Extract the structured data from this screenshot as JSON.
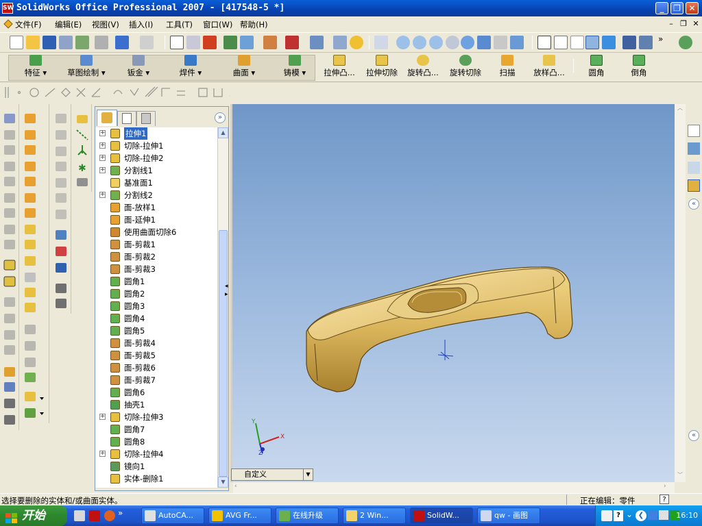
{
  "window": {
    "title": "SolidWorks Office Professional 2007 - [417548-5 *]",
    "app_icon_text": "SW",
    "colors": {
      "titlebar": "#0a4fc4",
      "selection": "#316ac5",
      "part": "#d8b155"
    }
  },
  "menubar": {
    "items": [
      "文件(F)",
      "编辑(E)",
      "视图(V)",
      "插入(I)",
      "工具(T)",
      "窗口(W)",
      "帮助(H)"
    ],
    "mdi_controls": [
      "–",
      "❐",
      "✕"
    ]
  },
  "command_manager": {
    "left_tabs": [
      "特征",
      "草图绘制",
      "钣金",
      "焊件",
      "曲面",
      "铸模"
    ],
    "commands": [
      "拉伸凸...",
      "拉伸切除",
      "旋转凸...",
      "旋转切除",
      "扫描",
      "放样凸...",
      "圆角",
      "倒角"
    ]
  },
  "feature_tree": {
    "items": [
      {
        "label": "拉伸1",
        "expand": "+",
        "icon": "extrude-boss-icon",
        "selected": true
      },
      {
        "label": "切除-拉伸1",
        "expand": "+",
        "icon": "cut-extrude-icon"
      },
      {
        "label": "切除-拉伸2",
        "expand": "+",
        "icon": "cut-extrude-icon"
      },
      {
        "label": "分割线1",
        "expand": "+",
        "icon": "split-line-icon"
      },
      {
        "label": "基准面1",
        "expand": "",
        "icon": "plane-icon"
      },
      {
        "label": "分割线2",
        "expand": "+",
        "icon": "split-line-icon"
      },
      {
        "label": "面-放样1",
        "expand": "",
        "icon": "surface-loft-icon"
      },
      {
        "label": "面-延伸1",
        "expand": "",
        "icon": "surface-extend-icon"
      },
      {
        "label": "使用曲面切除6",
        "expand": "",
        "icon": "surface-cut-icon"
      },
      {
        "label": "面-剪裁1",
        "expand": "",
        "icon": "surface-trim-icon"
      },
      {
        "label": "面-剪裁2",
        "expand": "",
        "icon": "surface-trim-icon"
      },
      {
        "label": "面-剪裁3",
        "expand": "",
        "icon": "surface-trim-icon"
      },
      {
        "label": "圆角1",
        "expand": "",
        "icon": "fillet-icon"
      },
      {
        "label": "圆角2",
        "expand": "",
        "icon": "fillet-icon"
      },
      {
        "label": "圆角3",
        "expand": "",
        "icon": "fillet-icon"
      },
      {
        "label": "圆角4",
        "expand": "",
        "icon": "fillet-icon"
      },
      {
        "label": "圆角5",
        "expand": "",
        "icon": "fillet-icon"
      },
      {
        "label": "面-剪裁4",
        "expand": "",
        "icon": "surface-trim-icon"
      },
      {
        "label": "面-剪裁5",
        "expand": "",
        "icon": "surface-trim-icon"
      },
      {
        "label": "面-剪裁6",
        "expand": "",
        "icon": "surface-trim-icon"
      },
      {
        "label": "面-剪裁7",
        "expand": "",
        "icon": "surface-trim-icon"
      },
      {
        "label": "圆角6",
        "expand": "",
        "icon": "fillet-icon"
      },
      {
        "label": "抽壳1",
        "expand": "",
        "icon": "shell-icon"
      },
      {
        "label": "切除-拉伸3",
        "expand": "+",
        "icon": "cut-extrude-icon"
      },
      {
        "label": "圆角7",
        "expand": "",
        "icon": "fillet-icon"
      },
      {
        "label": "圆角8",
        "expand": "",
        "icon": "fillet-icon"
      },
      {
        "label": "切除-拉伸4",
        "expand": "+",
        "icon": "cut-extrude-icon"
      },
      {
        "label": "镜向1",
        "expand": "",
        "icon": "mirror-icon"
      },
      {
        "label": "实体-删除1",
        "expand": "",
        "icon": "delete-body-icon"
      }
    ]
  },
  "viewport": {
    "config_select": "自定义",
    "triad": {
      "x": "X",
      "y": "Y",
      "z": "Z"
    }
  },
  "statusbar": {
    "message": "选择要删除的实体和/或曲面实体。",
    "mode": "正在编辑：零件",
    "help": "?"
  },
  "taskbar": {
    "start": "开始",
    "tasks": [
      {
        "label": "AutoCA...",
        "icon": "autocad-icon",
        "color": "#e0e0e0"
      },
      {
        "label": "AVG Fr...",
        "icon": "avg-icon",
        "color": "#f2c200"
      },
      {
        "label": "在线升级",
        "icon": "update-icon",
        "color": "#6ab04c"
      },
      {
        "label": "2 Win...",
        "icon": "folder-icon",
        "color": "#f4d36a"
      },
      {
        "label": "SolidW...",
        "icon": "solidworks-icon",
        "color": "#c01010",
        "active": true
      },
      {
        "label": "qw - 画图",
        "icon": "paint-icon",
        "color": "#d0d8f0"
      }
    ],
    "clock": "16:10"
  }
}
